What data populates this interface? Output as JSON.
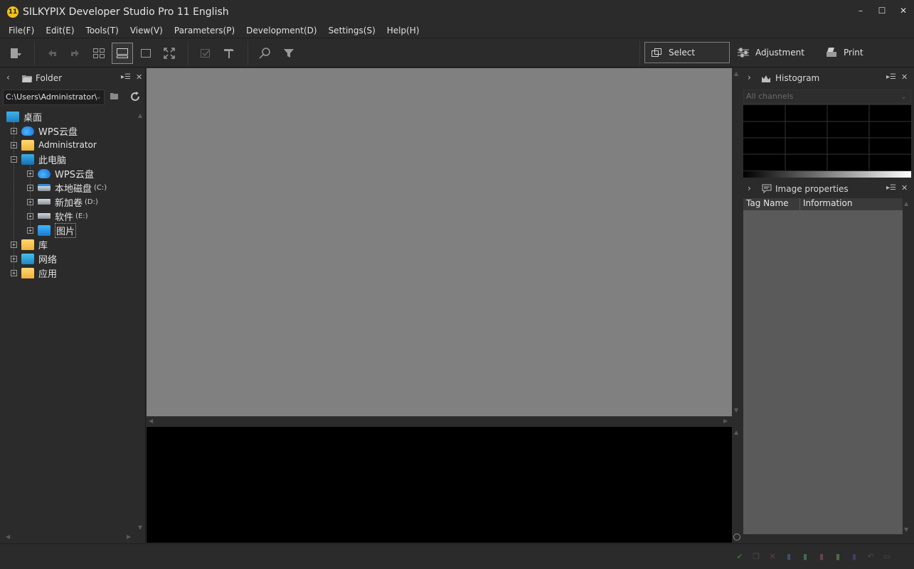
{
  "window": {
    "title": "SILKYPIX Developer Studio Pro 11 English",
    "app_icon_text": "11",
    "controls": {
      "minimize": "–",
      "maximize": "☐",
      "close": "✕"
    }
  },
  "menu": [
    "File(F)",
    "Edit(E)",
    "Tools(T)",
    "View(V)",
    "Parameters(P)",
    "Development(D)",
    "Settings(S)",
    "Help(H)"
  ],
  "modes": {
    "select": "Select",
    "adjustment": "Adjustment",
    "print": "Print"
  },
  "folder_panel": {
    "title": "Folder",
    "path": "C:\\Users\\Administrator\\",
    "tree": [
      {
        "label": "桌面",
        "sub": ""
      },
      {
        "label": "WPS云盘",
        "sub": ""
      },
      {
        "label": "Administrator",
        "sub": ""
      },
      {
        "label": "此电脑",
        "sub": ""
      },
      {
        "label": "WPS云盘",
        "sub": ""
      },
      {
        "label": "本地磁盘",
        "sub": "(C:)"
      },
      {
        "label": "新加卷",
        "sub": "(D:)"
      },
      {
        "label": "软件",
        "sub": "(E:)"
      },
      {
        "label": "图片",
        "sub": ""
      },
      {
        "label": "库",
        "sub": ""
      },
      {
        "label": "网络",
        "sub": ""
      },
      {
        "label": "应用",
        "sub": ""
      }
    ]
  },
  "histogram_panel": {
    "title": "Histogram",
    "channel_placeholder": "All channels"
  },
  "properties_panel": {
    "title": "Image properties",
    "columns": [
      "Tag Name",
      "Information"
    ]
  }
}
